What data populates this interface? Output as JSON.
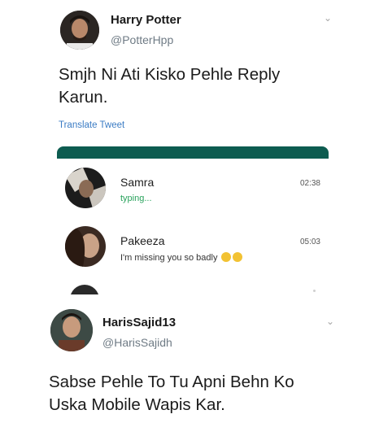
{
  "tweet1": {
    "name": "Harry Potter",
    "handle": "@PotterHpp",
    "text_line1": "Smjh Ni Ati Kisko Pehle Reply",
    "text_line2": "Karun.",
    "translate_label": "Translate Tweet",
    "menu_icon": "chevron-down-icon"
  },
  "chat": {
    "accent": "#0d5c50",
    "conversations": [
      {
        "name": "Samra",
        "preview": "typing...",
        "time": "02:38",
        "preview_color": "#2aa35d"
      },
      {
        "name": "Pakeeza",
        "preview": "I'm missing you so badly",
        "time": "05:03",
        "emoji": "crying-laughing-emoji"
      }
    ]
  },
  "tweet2": {
    "name": "HarisSajid13",
    "handle": "@HarisSajidh",
    "text_line1": "Sabse Pehle To Tu Apni Behn Ko",
    "text_line2": "Uska Mobile Wapis Kar.",
    "menu_icon": "chevron-down-icon"
  }
}
